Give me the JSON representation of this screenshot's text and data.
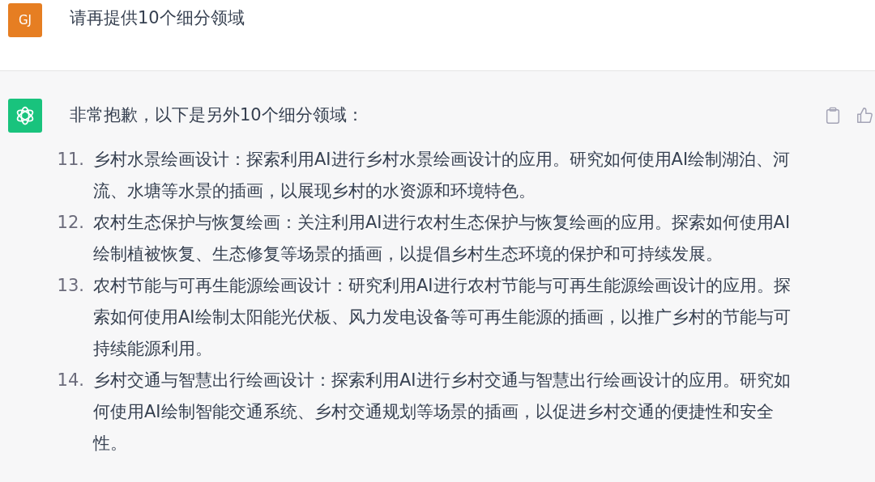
{
  "user_message": {
    "avatar": "GJ",
    "text": "请再提供10个细分领域"
  },
  "assistant_message": {
    "intro": "非常抱歉，以下是另外10个细分领域：",
    "items": [
      {
        "number": "11.",
        "text": "乡村水景绘画设计：探索利用AI进行乡村水景绘画设计的应用。研究如何使用AI绘制湖泊、河流、水塘等水景的插画，以展现乡村的水资源和环境特色。"
      },
      {
        "number": "12.",
        "text": "农村生态保护与恢复绘画：关注利用AI进行农村生态保护与恢复绘画的应用。探索如何使用AI绘制植被恢复、生态修复等场景的插画，以提倡乡村生态环境的保护和可持续发展。"
      },
      {
        "number": "13.",
        "text": "农村节能与可再生能源绘画设计：研究利用AI进行农村节能与可再生能源绘画设计的应用。探索如何使用AI绘制太阳能光伏板、风力发电设备等可再生能源的插画，以推广乡村的节能与可持续能源利用。"
      },
      {
        "number": "14.",
        "text": "乡村交通与智慧出行绘画设计：探索利用AI进行乡村交通与智慧出行绘画设计的应用。研究如何使用AI绘制智能交通系统、乡村交通规划等场景的插画，以促进乡村交通的便捷性和安全性。"
      }
    ]
  }
}
